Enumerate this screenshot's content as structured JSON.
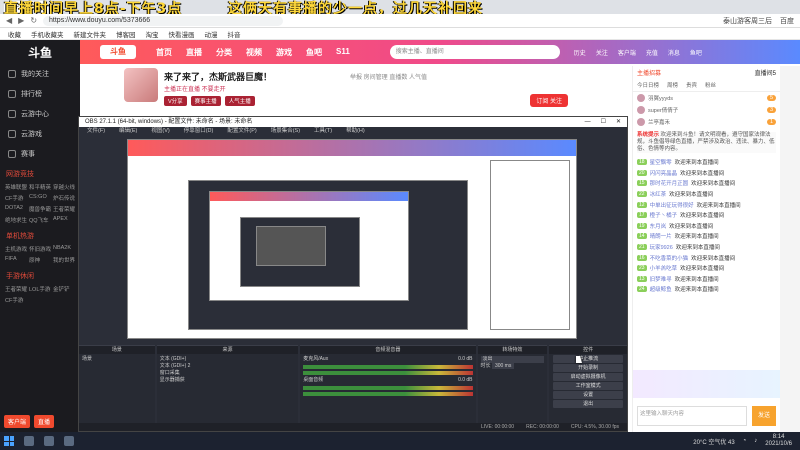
{
  "overlay": {
    "left_text": "直播时间早上8点-下午3点",
    "right_text": "这俩天有事播的少一点，过几天补回来"
  },
  "browser": {
    "tabs": [
      "主页",
      "新闻",
      "斗鱼直播"
    ],
    "url": "https://www.douyu.com/5373666",
    "right_items": [
      "泰山游客周三后",
      "百度"
    ],
    "bookmarks": [
      "收藏",
      "手机收藏夹",
      "新建文件夹",
      "博客园",
      "淘宝",
      "快看漫画",
      "动漫",
      "抖音"
    ]
  },
  "sidebar": {
    "logo": "斗鱼",
    "items": [
      "我的关注",
      "排行榜",
      "云游中心",
      "云游戏",
      "赛事"
    ],
    "section1": "网游竞技",
    "grid1": [
      "英雄联盟",
      "和平精英",
      "穿越火线",
      "CF手游",
      "CS:GO",
      "炉石传说",
      "DOTA2",
      "魔兽争霸",
      "王者荣耀",
      "绝地求生",
      "QQ飞车",
      "APEX"
    ],
    "section2": "单机热游",
    "grid2": [
      "主机游戏",
      "怀旧游戏",
      "NBA2K",
      "FIFA",
      "原神",
      "我的世界"
    ],
    "section3": "手游休闲",
    "grid3": [
      "王者荣耀",
      "LOL手游",
      "金铲铲",
      "CF手游"
    ],
    "bottom_buttons": [
      "客户端",
      "直播"
    ]
  },
  "douyu_header": {
    "logo": "斗鱼",
    "nav": [
      "首页",
      "直播",
      "分类",
      "视频",
      "游戏",
      "鱼吧",
      "S11"
    ],
    "search_placeholder": "搜索主播、直播间",
    "icons": [
      "历史",
      "关注",
      "客户端",
      "充值",
      "消息",
      "鱼吧"
    ]
  },
  "room": {
    "title": "来了来了，杰斯武器巨魔！",
    "meta": "举报  房间管理  直播数  人气值",
    "line2": "主播正在直播  不要走开",
    "tags": [
      "V分享",
      "赛事主播",
      "人气主播"
    ],
    "follow_label": "订阅 关注"
  },
  "obs": {
    "title": "OBS 27.1.1 (64-bit, windows) - 配置文件: 未命名 - 场景: 未命名",
    "menu": [
      "文件(F)",
      "编辑(E)",
      "视图(V)",
      "停靠窗口(D)",
      "配置文件(P)",
      "场景集合(S)",
      "工具(T)",
      "帮助(H)"
    ],
    "panels": {
      "scenes": {
        "title": "场景",
        "items": [
          "场景"
        ]
      },
      "sources": {
        "title": "来源",
        "items": [
          "文本 (GDI+)",
          "文本 (GDI+) 2",
          "窗口采集",
          "显示器捕获"
        ]
      },
      "mixer": {
        "title": "音频混音器",
        "tracks": [
          {
            "name": "麦克风/Aux",
            "db": "0.0 dB"
          },
          {
            "name": "桌面音频",
            "db": "0.0 dB"
          }
        ]
      },
      "transitions": {
        "title": "转场特效",
        "type": "淡出",
        "duration_label": "时长",
        "duration": "300 ms"
      },
      "controls": {
        "title": "控件",
        "buttons": [
          "停止推流",
          "开始录制",
          "启动虚拟摄像机",
          "工作室模式",
          "设置",
          "退出"
        ]
      }
    },
    "status": [
      "LIVE: 00:00:00",
      "REC: 00:00:00",
      "CPU: 4.5%, 30.00 fps"
    ]
  },
  "right_panel": {
    "tabs": [
      "主播招募",
      "直播间5"
    ],
    "subtabs": [
      "今日日榜",
      "周榜",
      "贵宾",
      "粉丝"
    ],
    "rank": [
      {
        "name": "羽翼yyyds",
        "score": "5"
      },
      {
        "name": "super倩倩子",
        "score": "3"
      },
      {
        "name": "兰亭嘉禾",
        "score": "1"
      }
    ],
    "notice_tag": "系统提示",
    "notice": "欢迎来到斗鱼！请文明观看，遵守国家法律法规，斗鱼倡导绿色直播，严禁涉及政治、违法、暴力、低俗、色情等内容。",
    "chat": [
      {
        "lv": "18",
        "name": "星空飘零",
        "msg": "欢迎来到本直播间"
      },
      {
        "lv": "20",
        "name": "闪闪亮晶晶",
        "msg": "欢迎来到本直播间"
      },
      {
        "lv": "15",
        "name": "那时花开月正圆",
        "msg": "欢迎来到本直播间"
      },
      {
        "lv": "22",
        "name": "冰红茶",
        "msg": "欢迎来到本直播间"
      },
      {
        "lv": "12",
        "name": "中单出征玩得很好",
        "msg": "欢迎来到本直播间"
      },
      {
        "lv": "17",
        "name": "橙子丶橘子",
        "msg": "欢迎来到本直播间"
      },
      {
        "lv": "19",
        "name": "东月岚",
        "msg": "欢迎来到本直播间"
      },
      {
        "lv": "14",
        "name": "晴朗一片",
        "msg": "欢迎来到本直播间"
      },
      {
        "lv": "21",
        "name": "玩家9926",
        "msg": "欢迎来到本直播间"
      },
      {
        "lv": "16",
        "name": "不吃香菜的小猫",
        "msg": "欢迎来到本直播间"
      },
      {
        "lv": "23",
        "name": "小羊羔吃草",
        "msg": "欢迎来到本直播间"
      },
      {
        "lv": "13",
        "name": "旧梦难寻",
        "msg": "欢迎来到本直播间"
      },
      {
        "lv": "24",
        "name": "超级鲸鱼",
        "msg": "欢迎来到本直播间"
      }
    ],
    "input_placeholder": "这里输入聊天内容",
    "send_label": "发送"
  },
  "taskbar": {
    "weather": "20°C 空气优 43",
    "time": "8:14",
    "date": "2021/10/6"
  }
}
